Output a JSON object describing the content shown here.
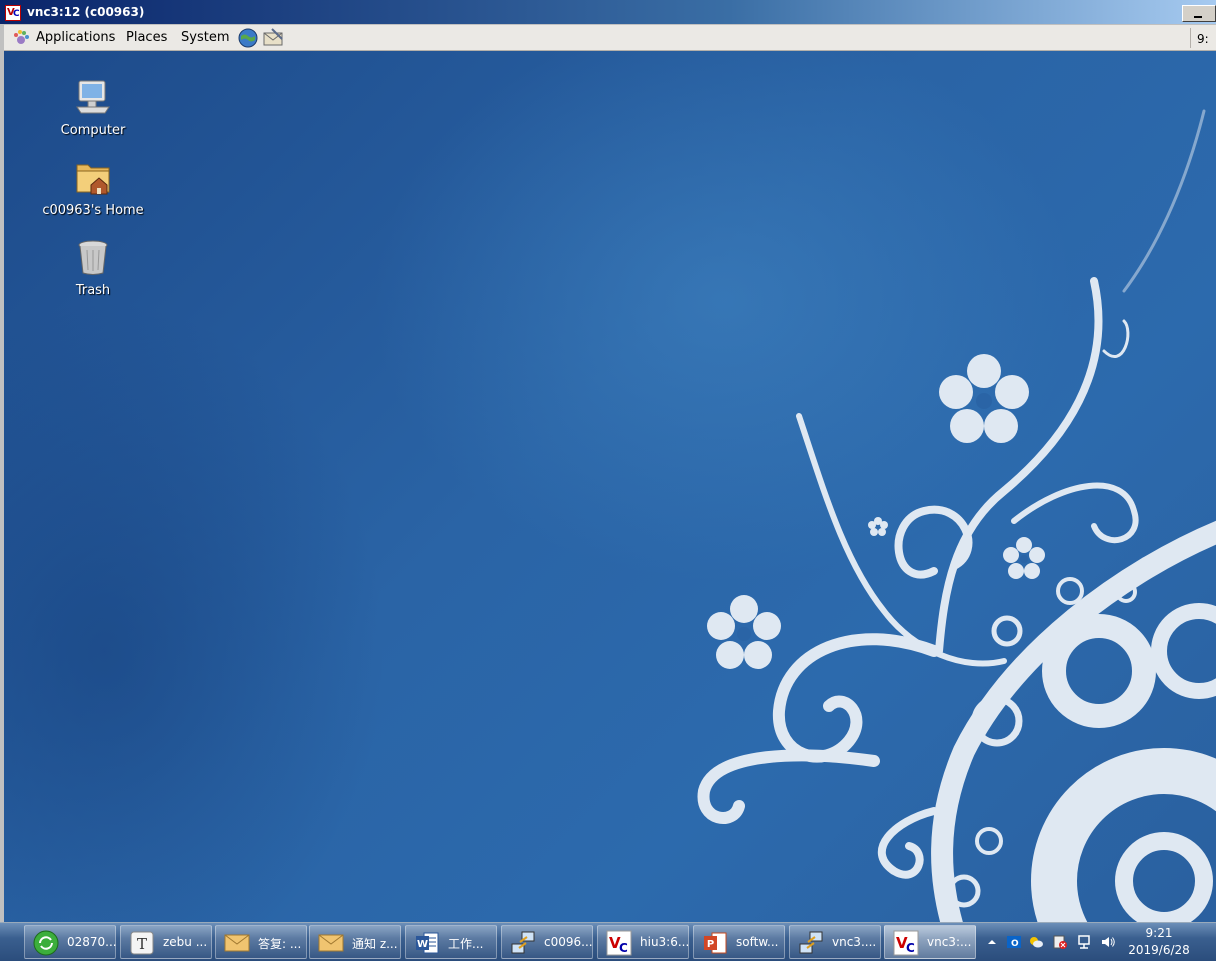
{
  "vnc_window": {
    "title": "vnc3:12 (c00963)",
    "logo_text": "V2"
  },
  "panel": {
    "menus": [
      "Applications",
      "Places",
      "System"
    ],
    "clock_partial": "9:"
  },
  "desktop": {
    "icons": [
      {
        "label": "Computer"
      },
      {
        "label": "c00963's Home"
      },
      {
        "label": "Trash"
      }
    ]
  },
  "taskbar": {
    "buttons": [
      {
        "label": "02870..."
      },
      {
        "label": "zebu ..."
      },
      {
        "label": "答复: ..."
      },
      {
        "label": "通知 z..."
      },
      {
        "label": "工作..."
      },
      {
        "label": "c0096..."
      },
      {
        "label": "hiu3:6..."
      },
      {
        "label": "softw..."
      },
      {
        "label": "vnc3...."
      },
      {
        "label": "vnc3:..."
      }
    ],
    "tray": {
      "time": "9:21",
      "date": "2019/6/28"
    }
  },
  "colors": {
    "desktop_blue": "#2a64a6",
    "title_blue": "#0a246a",
    "panel_gray": "#ebe9e5"
  }
}
